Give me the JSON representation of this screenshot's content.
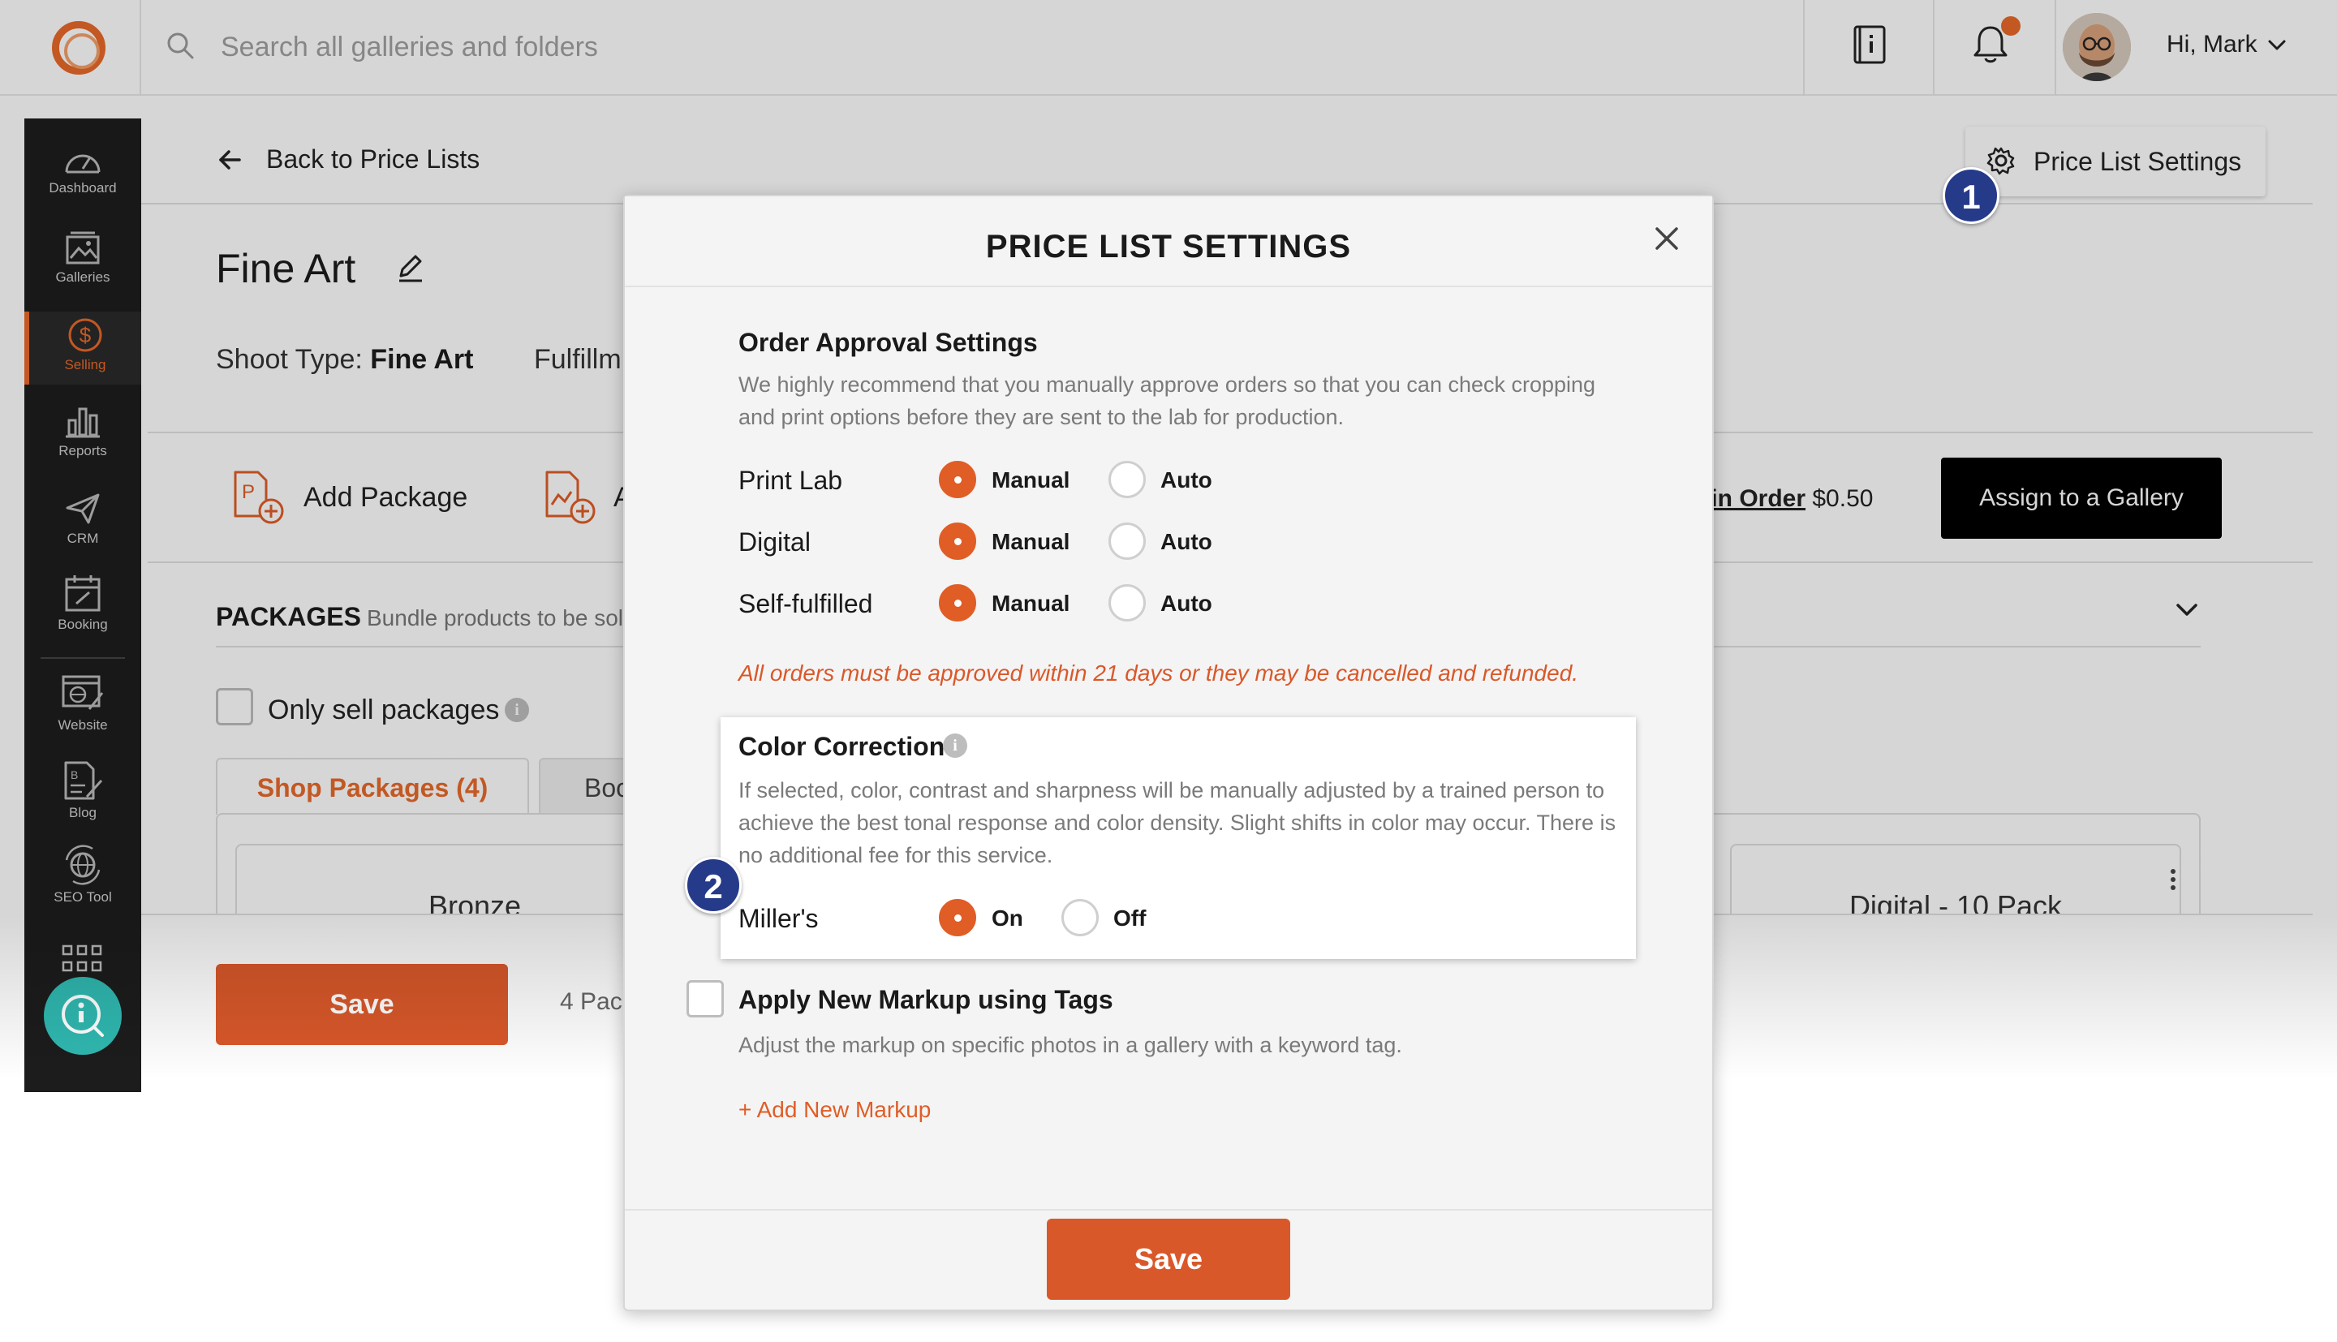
{
  "header": {
    "search_placeholder": "Search all galleries and folders",
    "greeting": "Hi, Mark"
  },
  "sidebar": {
    "items": [
      {
        "label": "Dashboard",
        "icon": "dashboard-icon"
      },
      {
        "label": "Galleries",
        "icon": "galleries-icon"
      },
      {
        "label": "Selling",
        "icon": "dollar-icon",
        "active": true
      },
      {
        "label": "Reports",
        "icon": "bar-chart-icon"
      },
      {
        "label": "CRM",
        "icon": "paper-plane-icon"
      },
      {
        "label": "Booking",
        "icon": "calendar-icon"
      },
      {
        "label": "Website",
        "icon": "website-icon"
      },
      {
        "label": "Blog",
        "icon": "blog-icon"
      },
      {
        "label": "SEO Tool",
        "icon": "seo-globe-icon"
      }
    ]
  },
  "page": {
    "back_label": "Back to Price Lists",
    "settings_button": "Price List Settings",
    "title": "Fine Art",
    "shoot_type_label": "Shoot Type:",
    "shoot_type_value": "Fine Art",
    "fulfillment_label": "Fulfillm",
    "add_package_label": "Add Package",
    "second_action_label": "A",
    "min_order_label": "lin Order",
    "min_order_value": "$0.50",
    "assign_button": "Assign to a Gallery",
    "packages_heading": "PACKAGES",
    "packages_sub": "Bundle products to be sol",
    "only_sell_label": "Only sell packages",
    "tab_shop": "Shop Packages (4)",
    "tab_other": "Boo",
    "card_left_title": "Bronze",
    "card_right_title": "Digital - 10 Pack",
    "save_button": "Save",
    "pack_count": "4 Pac"
  },
  "steps": {
    "one": "1",
    "two": "2"
  },
  "modal": {
    "title": "PRICE LIST SETTINGS",
    "order_approval": {
      "title": "Order Approval Settings",
      "description": "We highly recommend that you manually approve orders so that you can check cropping and print options before they are sent to the lab for production.",
      "rows": [
        {
          "label": "Print Lab",
          "selected": "Manual"
        },
        {
          "label": "Digital",
          "selected": "Manual"
        },
        {
          "label": "Self-fulfilled",
          "selected": "Manual"
        }
      ],
      "option_manual": "Manual",
      "option_auto": "Auto",
      "warning": "All orders must be approved within 21 days or they may be cancelled and refunded."
    },
    "color_correction": {
      "title": "Color Correction",
      "description": "If selected, color, contrast and sharpness will be manually adjusted by a trained person to achieve the best tonal response and color density. Slight shifts in color may occur. There is no additional fee for this service.",
      "lab_label": "Miller's",
      "option_on": "On",
      "option_off": "Off",
      "selected": "On"
    },
    "markup": {
      "title": "Apply New Markup using Tags",
      "description": "Adjust the markup on specific photos in a gallery with a keyword tag.",
      "add_link": "+ Add New Markup"
    },
    "save_button": "Save"
  },
  "colors": {
    "accent": "#e05d26",
    "sidebar_bg": "#1c1c1c",
    "step_badge": "#263a8a"
  }
}
